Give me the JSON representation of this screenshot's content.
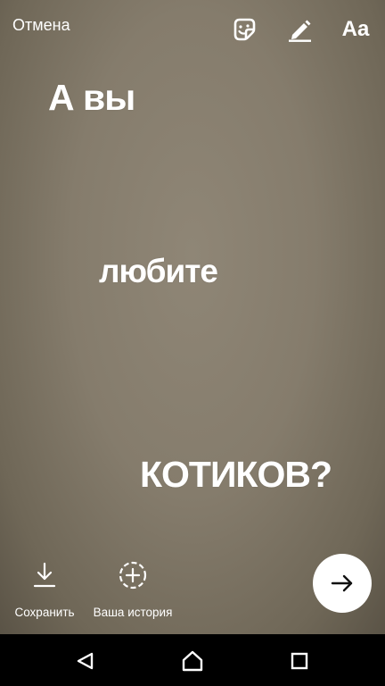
{
  "top_bar": {
    "cancel_label": "Отмена",
    "tools": [
      {
        "icon": "sticker-icon"
      },
      {
        "icon": "pen-icon"
      },
      {
        "icon": "text-tool-icon",
        "label": "Aa"
      }
    ]
  },
  "story": {
    "background": "#857c6c",
    "text_lines": [
      "А вы",
      "любите",
      "КОТИКОВ?"
    ]
  },
  "bottom_actions": {
    "save": {
      "icon": "download-icon",
      "label": "Сохранить"
    },
    "your_story": {
      "icon": "add-story-icon",
      "label": "Ваша история"
    },
    "send": {
      "icon": "arrow-right-icon"
    }
  },
  "nav_bar": {
    "buttons": [
      "back-icon",
      "home-icon",
      "recent-apps-icon"
    ]
  }
}
